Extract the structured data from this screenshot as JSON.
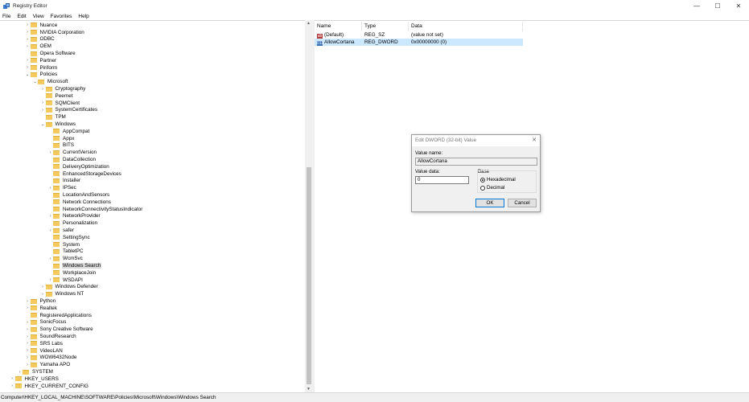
{
  "window": {
    "title": "Registry Editor",
    "minimize": "—",
    "maximize": "☐",
    "close": "✕"
  },
  "menu": [
    "File",
    "Edit",
    "View",
    "Favorites",
    "Help"
  ],
  "tree": [
    {
      "label": "Nuance",
      "indent": 3,
      "arrow": "›"
    },
    {
      "label": "NVIDIA Corporation",
      "indent": 3,
      "arrow": "›"
    },
    {
      "label": "ODBC",
      "indent": 3,
      "arrow": "›"
    },
    {
      "label": "OEM",
      "indent": 3,
      "arrow": "›"
    },
    {
      "label": "Opera Software",
      "indent": 3,
      "arrow": ""
    },
    {
      "label": "Partner",
      "indent": 3,
      "arrow": "›"
    },
    {
      "label": "Piriform",
      "indent": 3,
      "arrow": "›"
    },
    {
      "label": "Policies",
      "indent": 3,
      "arrow": "⌄"
    },
    {
      "label": "Microsoft",
      "indent": 4,
      "arrow": "⌄"
    },
    {
      "label": "Cryptography",
      "indent": 5,
      "arrow": "›"
    },
    {
      "label": "Peernet",
      "indent": 5,
      "arrow": ""
    },
    {
      "label": "SQMClient",
      "indent": 5,
      "arrow": "›"
    },
    {
      "label": "SystemCertificates",
      "indent": 5,
      "arrow": "›"
    },
    {
      "label": "TPM",
      "indent": 5,
      "arrow": ""
    },
    {
      "label": "Windows",
      "indent": 5,
      "arrow": "⌄"
    },
    {
      "label": "AppCompat",
      "indent": 6,
      "arrow": ""
    },
    {
      "label": "Appx",
      "indent": 6,
      "arrow": ""
    },
    {
      "label": "BITS",
      "indent": 6,
      "arrow": ""
    },
    {
      "label": "CurrentVersion",
      "indent": 6,
      "arrow": "›"
    },
    {
      "label": "DataCollection",
      "indent": 6,
      "arrow": ""
    },
    {
      "label": "DeliveryOptimization",
      "indent": 6,
      "arrow": ""
    },
    {
      "label": "EnhancedStorageDevices",
      "indent": 6,
      "arrow": ""
    },
    {
      "label": "Installer",
      "indent": 6,
      "arrow": ""
    },
    {
      "label": "IPSec",
      "indent": 6,
      "arrow": "›"
    },
    {
      "label": "LocationAndSensors",
      "indent": 6,
      "arrow": ""
    },
    {
      "label": "Network Connections",
      "indent": 6,
      "arrow": ""
    },
    {
      "label": "NetworkConnectivityStatusIndicator",
      "indent": 6,
      "arrow": ""
    },
    {
      "label": "NetworkProvider",
      "indent": 6,
      "arrow": "›"
    },
    {
      "label": "Personalization",
      "indent": 6,
      "arrow": ""
    },
    {
      "label": "safer",
      "indent": 6,
      "arrow": "›"
    },
    {
      "label": "SettingSync",
      "indent": 6,
      "arrow": ""
    },
    {
      "label": "System",
      "indent": 6,
      "arrow": ""
    },
    {
      "label": "TabletPC",
      "indent": 6,
      "arrow": ""
    },
    {
      "label": "WcmSvc",
      "indent": 6,
      "arrow": "›"
    },
    {
      "label": "Windows Search",
      "indent": 6,
      "arrow": "",
      "selected": true
    },
    {
      "label": "WorkplaceJoin",
      "indent": 6,
      "arrow": ""
    },
    {
      "label": "WSDAPI",
      "indent": 6,
      "arrow": "›"
    },
    {
      "label": "Windows Defender",
      "indent": 5,
      "arrow": "›"
    },
    {
      "label": "Windows NT",
      "indent": 5,
      "arrow": "›"
    },
    {
      "label": "Python",
      "indent": 3,
      "arrow": "›"
    },
    {
      "label": "Realtek",
      "indent": 3,
      "arrow": "›"
    },
    {
      "label": "RegisteredApplications",
      "indent": 3,
      "arrow": ""
    },
    {
      "label": "SonicFocus",
      "indent": 3,
      "arrow": "›"
    },
    {
      "label": "Sony Creative Software",
      "indent": 3,
      "arrow": "›"
    },
    {
      "label": "SoundResearch",
      "indent": 3,
      "arrow": "›"
    },
    {
      "label": "SRS Labs",
      "indent": 3,
      "arrow": "›"
    },
    {
      "label": "VideoLAN",
      "indent": 3,
      "arrow": "›"
    },
    {
      "label": "WOW6432Node",
      "indent": 3,
      "arrow": "›"
    },
    {
      "label": "Yamaha APO",
      "indent": 3,
      "arrow": "›"
    },
    {
      "label": "SYSTEM",
      "indent": 2,
      "arrow": "›"
    },
    {
      "label": "HKEY_USERS",
      "indent": 1,
      "arrow": "›"
    },
    {
      "label": "HKEY_CURRENT_CONFIG",
      "indent": 1,
      "arrow": "›"
    }
  ],
  "list": {
    "columns": {
      "name": "Name",
      "type": "Type",
      "data": "Data"
    },
    "rows": [
      {
        "icon": "ab",
        "name": "(Default)",
        "type": "REG_SZ",
        "data": "(value not set)"
      },
      {
        "icon": "011",
        "name": "AllowCortana",
        "type": "REG_DWORD",
        "data": "0x00000000 (0)"
      }
    ]
  },
  "statusbar": {
    "path": "Computer\\HKEY_LOCAL_MACHINE\\SOFTWARE\\Policies\\Microsoft\\Windows\\Windows Search"
  },
  "dialog": {
    "title": "Edit DWORD (32-bit) Value",
    "close": "✕",
    "value_name_label": "Value name:",
    "value_name": "AllowCortana",
    "value_data_label": "Value data:",
    "value_data": "0",
    "base_label": "Base",
    "hex_label": "Hexadecimal",
    "dec_label": "Decimal",
    "ok_label": "OK",
    "cancel_label": "Cancel"
  },
  "colors": {
    "selection": "#cce8ff",
    "folder": "#f4c95d",
    "tree_selected": "#d9d9d9"
  }
}
